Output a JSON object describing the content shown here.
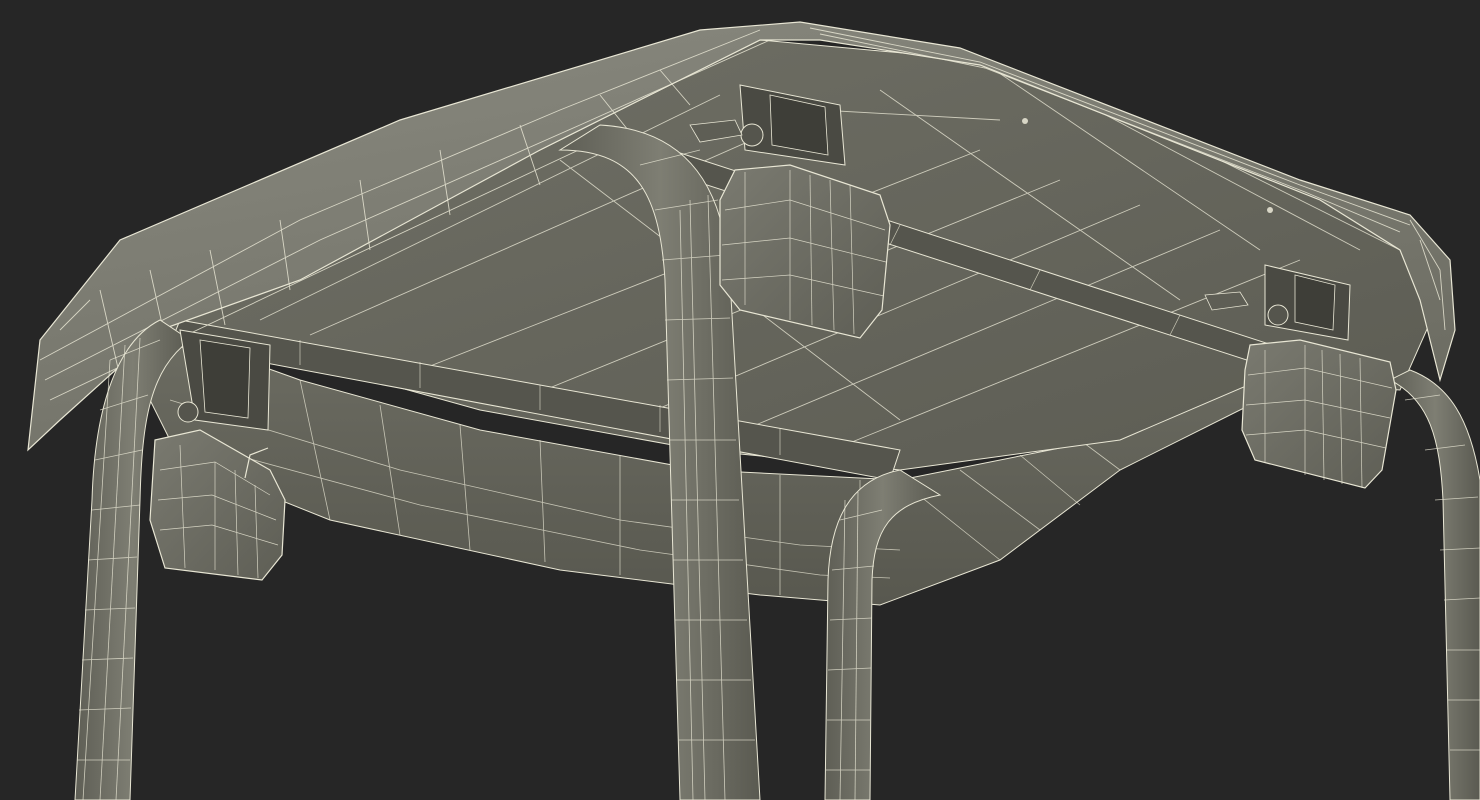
{
  "scene": {
    "subject": "",
    "background_color": "#262626",
    "model_color": "#6a6a60",
    "wire_color": "#e8e6d4"
  }
}
